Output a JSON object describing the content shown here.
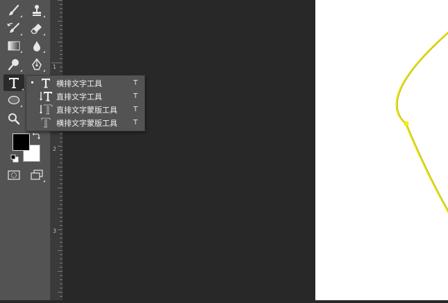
{
  "tools": {
    "brush": "brush-tool",
    "stamp": "clone-stamp-tool",
    "history_brush": "history-brush-tool",
    "eraser": "eraser-tool",
    "gradient": "gradient-tool",
    "blur": "blur-tool",
    "dodge": "dodge-tool",
    "pen": "pen-tool",
    "type": "type-tool",
    "ellipse": "ellipse-tool",
    "zoom": "zoom-tool"
  },
  "ruler": {
    "marks": [
      "1",
      "2",
      "3"
    ]
  },
  "flyout": {
    "items": [
      {
        "label": "横排文字工具",
        "shortcut": "T",
        "icon": "horizontal-type-icon"
      },
      {
        "label": "直排文字工具",
        "shortcut": "T",
        "icon": "vertical-type-icon"
      },
      {
        "label": "直排文字蒙版工具",
        "shortcut": "T",
        "icon": "vertical-type-mask-icon"
      },
      {
        "label": "横排文字蒙版工具",
        "shortcut": "T",
        "icon": "horizontal-type-mask-icon"
      }
    ]
  },
  "colors": {
    "foreground": "#000000",
    "background": "#ffffff",
    "path_stroke": "#e8e200",
    "anchor_point": "#f2ee00"
  }
}
